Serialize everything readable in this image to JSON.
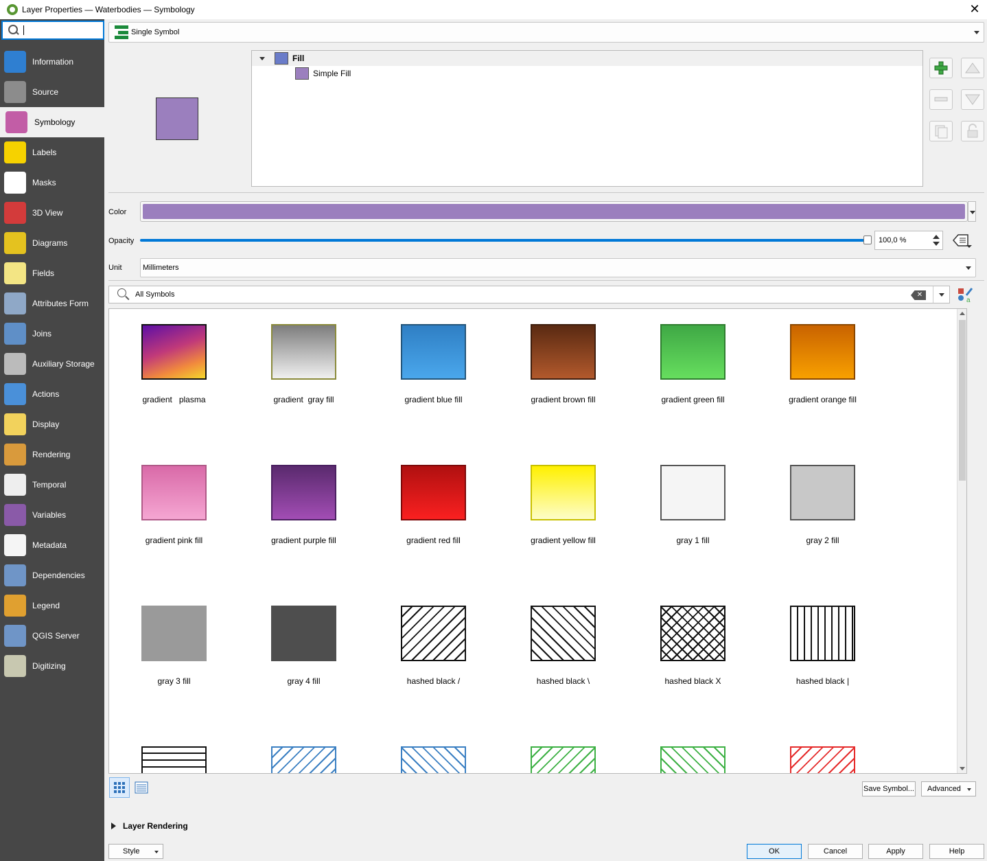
{
  "window": {
    "title": "Layer Properties — Waterbodies — Symbology"
  },
  "sidebar": {
    "search_value": "",
    "items": [
      {
        "label": "Information",
        "icon": "information-icon",
        "color": "#2f7fd1"
      },
      {
        "label": "Source",
        "icon": "source-wrench-icon",
        "color": "#8c8c8c"
      },
      {
        "label": "Symbology",
        "icon": "symbology-brush-icon",
        "color": "#c25da6",
        "active": true
      },
      {
        "label": "Labels",
        "icon": "labels-abc-icon",
        "color": "#f6d200"
      },
      {
        "label": "Masks",
        "icon": "masks-abc-icon",
        "color": "#ffffff"
      },
      {
        "label": "3D View",
        "icon": "3d-cube-icon",
        "color": "#d33b3b"
      },
      {
        "label": "Diagrams",
        "icon": "diagrams-pie-icon",
        "color": "#e4c21f"
      },
      {
        "label": "Fields",
        "icon": "fields-table-icon",
        "color": "#f3e584"
      },
      {
        "label": "Attributes Form",
        "icon": "attributes-form-icon",
        "color": "#8fa8c7"
      },
      {
        "label": "Joins",
        "icon": "joins-icon",
        "color": "#5f8fc7"
      },
      {
        "label": "Auxiliary Storage",
        "icon": "auxiliary-storage-database-icon",
        "color": "#bbbbbb"
      },
      {
        "label": "Actions",
        "icon": "actions-gear-icon",
        "color": "#4a90d9"
      },
      {
        "label": "Display",
        "icon": "display-speech-bubble-icon",
        "color": "#f2d25c"
      },
      {
        "label": "Rendering",
        "icon": "rendering-brush-icon",
        "color": "#d99a3c"
      },
      {
        "label": "Temporal",
        "icon": "temporal-clock-icon",
        "color": "#eeeeee"
      },
      {
        "label": "Variables",
        "icon": "variables-epsilon-icon",
        "color": "#8a5aa8"
      },
      {
        "label": "Metadata",
        "icon": "metadata-document-icon",
        "color": "#f5f5f5"
      },
      {
        "label": "Dependencies",
        "icon": "dependencies-icon",
        "color": "#6f95c7"
      },
      {
        "label": "Legend",
        "icon": "legend-icon",
        "color": "#e0a030"
      },
      {
        "label": "QGIS Server",
        "icon": "qgis-server-icon",
        "color": "#6f95c7"
      },
      {
        "label": "Digitizing",
        "icon": "digitizing-map-icon",
        "color": "#c8c8b0"
      }
    ]
  },
  "renderer": {
    "selected": "Single Symbol"
  },
  "symbol_tree": {
    "root": {
      "label": "Fill",
      "color": "#6a7cc9"
    },
    "layers": [
      {
        "label": "Simple Fill",
        "color": "#9b7fbe"
      }
    ]
  },
  "symbol_color": "#9b7fbe",
  "form": {
    "color_label": "Color",
    "opacity_label": "Opacity",
    "opacity_value": "100,0 %",
    "opacity_fraction": 1.0,
    "unit_label": "Unit",
    "unit_value": "Millimeters"
  },
  "library": {
    "search_value": "All Symbols",
    "symbols": [
      {
        "name": "gradient   plasma",
        "kind": "gradient",
        "from": "#5d0fa5",
        "to": "#f4d72c",
        "border": "#111"
      },
      {
        "name": "gradient  gray fill",
        "kind": "vgradient",
        "from": "#7d7d7d",
        "to": "#f0f0f0",
        "border": "#8a8a3a"
      },
      {
        "name": "gradient blue fill",
        "kind": "vgradient",
        "from": "#2f7fc4",
        "to": "#4aa7ec",
        "border": "#24557a"
      },
      {
        "name": "gradient brown fill",
        "kind": "vgradient",
        "from": "#5a2a12",
        "to": "#b2592c",
        "border": "#3e1e0e"
      },
      {
        "name": "gradient green fill",
        "kind": "vgradient",
        "from": "#3fa845",
        "to": "#66de5e",
        "border": "#2f7d2f"
      },
      {
        "name": "gradient orange fill",
        "kind": "vgradient",
        "from": "#c96300",
        "to": "#f8a000",
        "border": "#8a4700"
      },
      {
        "name": "gradient pink fill",
        "kind": "vgradient",
        "from": "#d96aa8",
        "to": "#f5a6d2",
        "border": "#b05a88"
      },
      {
        "name": "gradient purple fill",
        "kind": "vgradient",
        "from": "#5a2a6e",
        "to": "#a24db4",
        "border": "#4a2060"
      },
      {
        "name": "gradient red fill",
        "kind": "vgradient",
        "from": "#b01010",
        "to": "#fa2020",
        "border": "#7d0a0a"
      },
      {
        "name": "gradient yellow fill",
        "kind": "vgradient",
        "from": "#fff000",
        "to": "#fdfdc8",
        "border": "#c8c000"
      },
      {
        "name": "gray 1 fill",
        "kind": "solid",
        "from": "#f5f5f5",
        "border": "#555"
      },
      {
        "name": "gray 2 fill",
        "kind": "solid",
        "from": "#c8c8c8",
        "border": "#555"
      },
      {
        "name": "gray 3 fill",
        "kind": "solid",
        "from": "#9a9a9a",
        "border": "#9a9a9a"
      },
      {
        "name": "gray 4 fill",
        "kind": "solid",
        "from": "#4e4e4e",
        "border": "#4e4e4e"
      },
      {
        "name": "hashed black /",
        "kind": "hatch-fwd",
        "from": "#111",
        "border": "#111"
      },
      {
        "name": "hashed black \\",
        "kind": "hatch-back",
        "from": "#111",
        "border": "#111"
      },
      {
        "name": "hashed black X",
        "kind": "hatch-x",
        "from": "#111",
        "border": "#111"
      },
      {
        "name": "hashed black |",
        "kind": "hatch-v",
        "from": "#111",
        "border": "#111"
      },
      {
        "name": "",
        "kind": "hatch-h",
        "from": "#111",
        "border": "#111"
      },
      {
        "name": "",
        "kind": "hatch-fwd",
        "from": "#3a7fc2",
        "border": "#3a7fc2"
      },
      {
        "name": "",
        "kind": "hatch-back",
        "from": "#3a7fc2",
        "border": "#3a7fc2"
      },
      {
        "name": "",
        "kind": "hatch-fwd",
        "from": "#3cb043",
        "border": "#3cb043"
      },
      {
        "name": "",
        "kind": "hatch-back",
        "from": "#3cb043",
        "border": "#3cb043"
      },
      {
        "name": "",
        "kind": "hatch-fwd",
        "from": "#e52b2b",
        "border": "#e52b2b"
      }
    ]
  },
  "buttons": {
    "save_symbol": "Save Symbol...",
    "advanced": "Advanced",
    "layer_rendering": "Layer Rendering",
    "style": "Style",
    "ok": "OK",
    "cancel": "Cancel",
    "apply": "Apply",
    "help": "Help"
  }
}
